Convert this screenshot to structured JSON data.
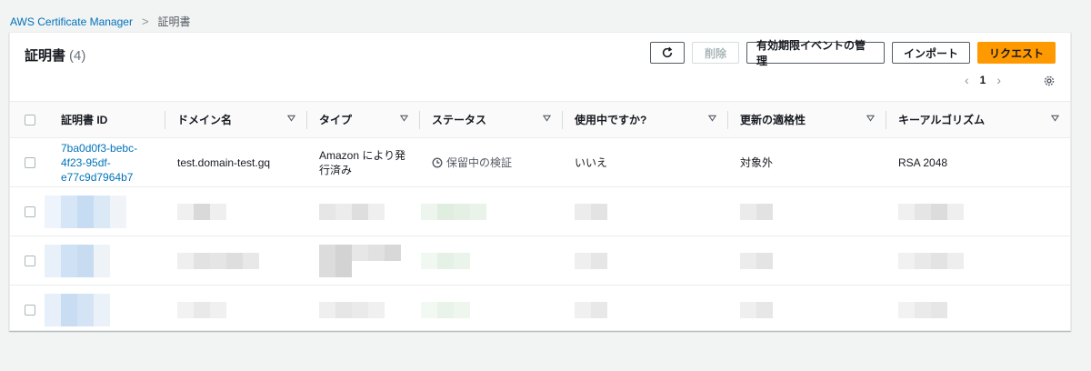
{
  "breadcrumb": {
    "root": "AWS Certificate Manager",
    "current": "証明書"
  },
  "panel": {
    "title": "証明書",
    "count": "(4)"
  },
  "toolbar": {
    "delete_label": "削除",
    "manage_events_label": "有効期限イベントの管理",
    "import_label": "インポート",
    "request_label": "リクエスト"
  },
  "pagination": {
    "page": "1"
  },
  "table": {
    "columns": {
      "id": "証明書 ID",
      "domain": "ドメイン名",
      "type": "タイプ",
      "status": "ステータス",
      "in_use": "使用中ですか?",
      "renewal": "更新の適格性",
      "algorithm": "キーアルゴリズム"
    },
    "row1": {
      "id_line1": "7ba0d0f3-bebc-",
      "id_line2": "4f23-95df-",
      "id_line3": "e77c9d7964b7",
      "domain": "test.domain-test.gq",
      "type_line1": "Amazon により発",
      "type_line2": "行済み",
      "status": "保留中の検証",
      "in_use": "いいえ",
      "renewal": "対象外",
      "algorithm": "RSA 2048"
    }
  },
  "colors": {
    "link": "#0073bb",
    "primary": "#ff9900",
    "background": "#f2f3f3"
  }
}
